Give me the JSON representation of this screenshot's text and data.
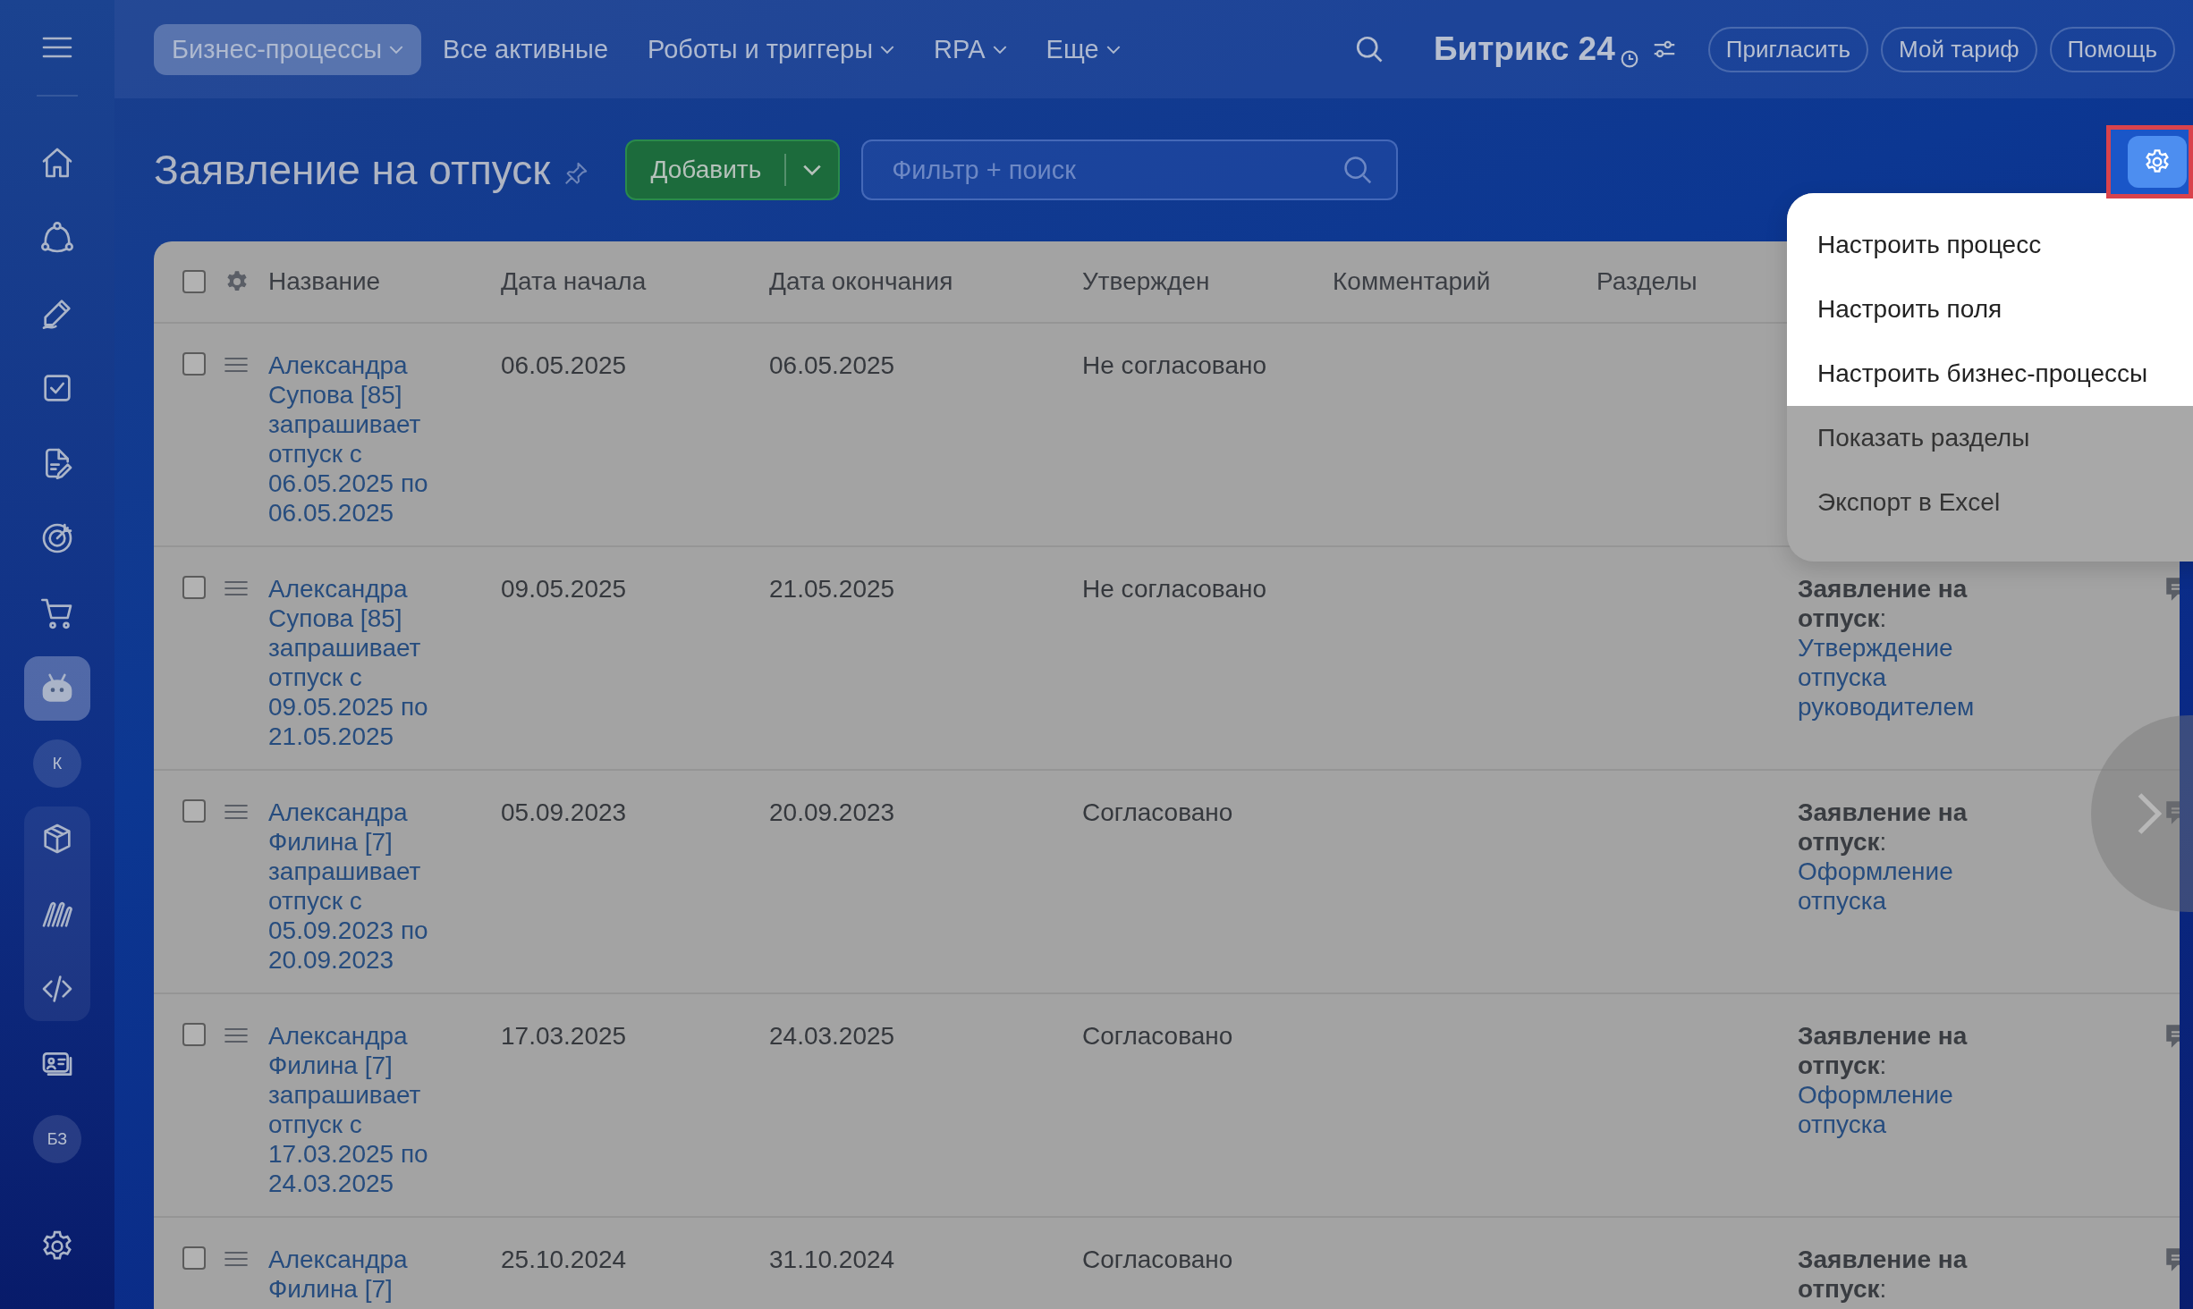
{
  "sidebar": {
    "items": [
      {
        "kind": "icon",
        "selected": false
      },
      {
        "kind": "icon",
        "selected": false
      },
      {
        "kind": "icon",
        "selected": false
      },
      {
        "kind": "icon",
        "selected": false
      },
      {
        "kind": "icon",
        "selected": false
      },
      {
        "kind": "icon",
        "selected": false
      },
      {
        "kind": "icon",
        "selected": false
      },
      {
        "kind": "icon",
        "selected": true
      },
      {
        "kind": "avatar",
        "label": "К",
        "selected": false
      },
      {
        "kind": "group",
        "children": [
          {
            "kind": "icon",
            "selected": false
          },
          {
            "kind": "icon",
            "selected": false
          },
          {
            "kind": "icon",
            "selected": false
          }
        ]
      },
      {
        "kind": "icon",
        "selected": false
      },
      {
        "kind": "avatar",
        "label": "БЗ",
        "selected": false
      }
    ]
  },
  "top_nav": {
    "tabs": [
      {
        "label": "Бизнес-процессы",
        "selected": true,
        "dropdown": true
      },
      {
        "label": "Все активные",
        "selected": false,
        "dropdown": false
      },
      {
        "label": "Роботы и триггеры",
        "selected": false,
        "dropdown": true
      },
      {
        "label": "RPA",
        "selected": false,
        "dropdown": true
      },
      {
        "label": "Еще",
        "selected": false,
        "dropdown": true
      }
    ],
    "logo": {
      "name": "Битрикс",
      "suffix": "24"
    },
    "buttons": [
      "Пригласить",
      "Мой тариф",
      "Помощь"
    ]
  },
  "page": {
    "title": "Заявление на отпуск",
    "add_button": "Добавить",
    "search": {
      "placeholder": "Фильтр + поиск"
    }
  },
  "settings_menu": {
    "items": [
      {
        "label": "Настроить процесс",
        "highlighted": true
      },
      {
        "label": "Настроить поля",
        "highlighted": true
      },
      {
        "label": "Настроить бизнес-процессы",
        "highlighted": true
      },
      {
        "label": "Показать разделы",
        "highlighted": false
      },
      {
        "label": "Экспорт в Excel",
        "highlighted": false
      }
    ]
  },
  "table": {
    "select_all": false,
    "columns": [
      "Название",
      "Дата начала",
      "Дата окончания",
      "Утвержден",
      "Комментарий",
      "Разделы"
    ],
    "rows": [
      {
        "name": "Александра Супова [85] запрашивает отпуск с 06.05.2025 по 06.05.2025",
        "start": "06.05.2025",
        "end": "06.05.2025",
        "approved": "Не согласовано",
        "checked": false
      },
      {
        "name": "Александра Супова [85] запрашивает отпуск с 09.05.2025 по 21.05.2025",
        "start": "09.05.2025",
        "end": "21.05.2025",
        "approved": "Не согласовано",
        "checked": false,
        "process": {
          "title": "**Заявление на отпуск**:",
          "link": "Утверждение отпуска руководителем"
        }
      },
      {
        "name": "Александра Филина [7] запрашивает отпуск с 05.09.2023 по 20.09.2023",
        "start": "05.09.2023",
        "end": "20.09.2023",
        "approved": "Согласовано",
        "checked": false,
        "process": {
          "title": "**Заявление на отпуск**:",
          "link": "Оформление отпуска"
        }
      },
      {
        "name": "Александра Филина [7] запрашивает отпуск с 17.03.2025 по 24.03.2025",
        "start": "17.03.2025",
        "end": "24.03.2025",
        "approved": "Согласовано",
        "checked": false,
        "process": {
          "title": "**Заявление на отпуск**:",
          "link": "Оформление отпуска"
        }
      },
      {
        "name": "Александра Филина [7]",
        "start": "25.10.2024",
        "end": "31.10.2024",
        "approved": "Согласовано",
        "checked": false,
        "process": {
          "title": "**Заявление на отпуск**:"
        }
      }
    ]
  }
}
